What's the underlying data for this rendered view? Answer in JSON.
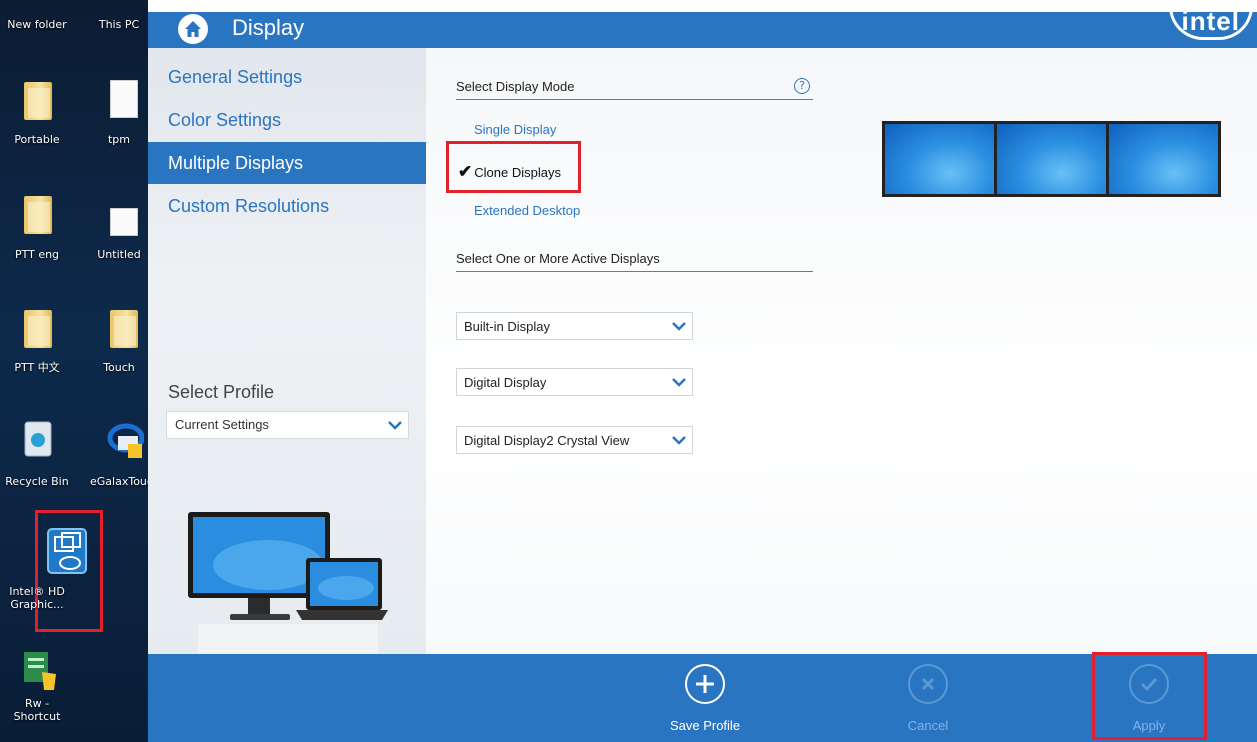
{
  "desktop": {
    "icons": [
      {
        "label": "New folder"
      },
      {
        "label": "This PC"
      },
      {
        "label": "Portable"
      },
      {
        "label": "tpm"
      },
      {
        "label": "PTT eng"
      },
      {
        "label": "Untitled"
      },
      {
        "label": "PTT 中文"
      },
      {
        "label": "Touch"
      },
      {
        "label": "Recycle Bin"
      },
      {
        "label": "eGalaxTouch"
      },
      {
        "label": "Intel® HD Graphic..."
      },
      {
        "label": "Rw - Shortcut"
      }
    ]
  },
  "header": {
    "title": "Display",
    "brand": "intel"
  },
  "nav": {
    "items": [
      {
        "label": "General Settings"
      },
      {
        "label": "Color Settings"
      },
      {
        "label": "Multiple Displays",
        "active": true
      },
      {
        "label": "Custom Resolutions"
      }
    ]
  },
  "profile": {
    "label": "Select Profile",
    "selected": "Current Settings"
  },
  "display_mode": {
    "label": "Select Display Mode",
    "help": "?",
    "options": [
      {
        "label": "Single Display"
      },
      {
        "label": "Clone Displays",
        "checked": true
      },
      {
        "label": "Extended Desktop"
      }
    ]
  },
  "active_displays": {
    "label": "Select One or More Active Displays",
    "dropdowns": [
      {
        "selected": "Built-in Display"
      },
      {
        "selected": "Digital Display"
      },
      {
        "selected": "Digital Display2 Crystal View"
      }
    ]
  },
  "bottom": {
    "save_label": "Save Profile",
    "cancel_label": "Cancel",
    "apply_label": "Apply"
  },
  "colors": {
    "accent": "#2a75c2",
    "highlight": "#e5202d",
    "desktop_bg": "#0c1c33"
  }
}
